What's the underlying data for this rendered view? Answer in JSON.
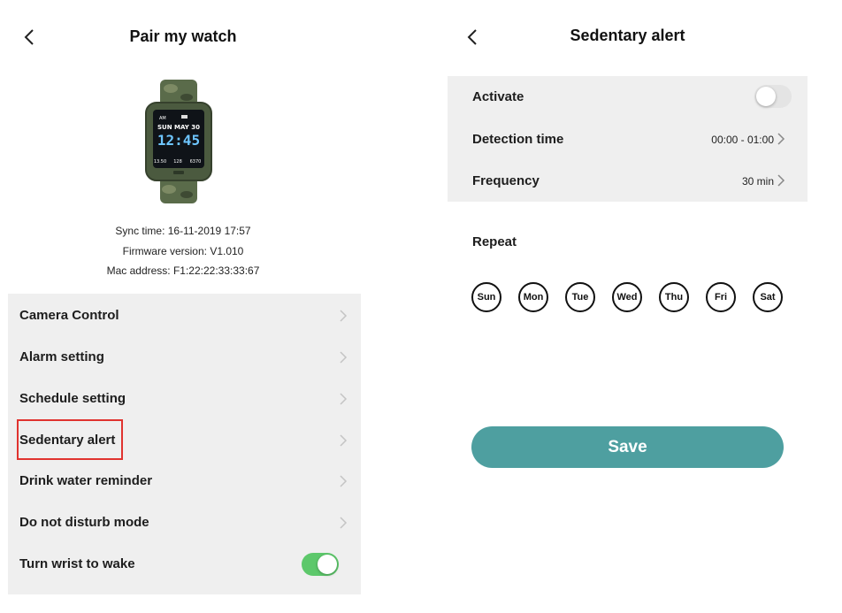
{
  "left": {
    "title": "Pair my watch",
    "watch": {
      "top_labels": [
        "AM"
      ],
      "date": "SUN MAY 30",
      "time": "12:45",
      "stats": [
        "13.50",
        "128",
        "6370"
      ]
    },
    "device": {
      "sync_time": "Sync time: 16-11-2019 17:57",
      "firmware": "Firmware version: V1.010",
      "mac": "Mac address: F1:22:22:33:33:67"
    },
    "settings": [
      {
        "label": "Camera Control"
      },
      {
        "label": "Alarm setting"
      },
      {
        "label": "Schedule setting"
      },
      {
        "label": "Sedentary alert"
      },
      {
        "label": "Drink water reminder"
      },
      {
        "label": "Do not disturb mode"
      }
    ],
    "wrist": {
      "label": "Turn wrist to wake",
      "on": true
    }
  },
  "right": {
    "title": "Sedentary alert",
    "activate": {
      "label": "Activate",
      "on": false
    },
    "detection": {
      "label": "Detection time",
      "value": "00:00 - 01:00"
    },
    "frequency": {
      "label": "Frequency",
      "value": "30 min"
    },
    "repeat_label": "Repeat",
    "days": [
      "Sun",
      "Mon",
      "Tue",
      "Wed",
      "Thu",
      "Fri",
      "Sat"
    ],
    "save_label": "Save"
  },
  "colors": {
    "accent": "#4e9fa0",
    "toggle_on": "#5dc86b",
    "highlight": "#e0332f",
    "panel_bg": "#efefef"
  },
  "icons": [
    "back-arrow-icon",
    "chevron-right-icon"
  ]
}
